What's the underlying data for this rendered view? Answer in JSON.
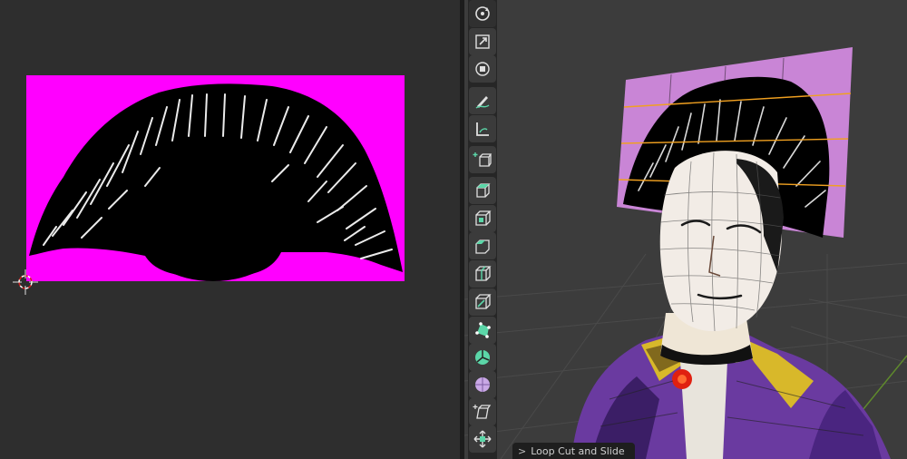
{
  "uv_editor": {
    "texture": {
      "background_color": "#ff00ff",
      "hair_color": "#000000"
    }
  },
  "toolbar": {
    "tools": [
      {
        "name": "rotate-tool",
        "icon": "rotate-icon"
      },
      {
        "name": "scale-tool",
        "icon": "scale-icon"
      },
      {
        "name": "transform-tool",
        "icon": "transform-icon"
      },
      {
        "name": "annotate-tool",
        "icon": "annotate-icon"
      },
      {
        "name": "measure-tool",
        "icon": "measure-icon"
      },
      {
        "name": "add-cube-tool",
        "icon": "add-cube-icon"
      },
      {
        "name": "extrude-region-tool",
        "icon": "extrude-icon"
      },
      {
        "name": "inset-faces-tool",
        "icon": "inset-icon"
      },
      {
        "name": "bevel-tool",
        "icon": "bevel-icon"
      },
      {
        "name": "loop-cut-tool",
        "icon": "loop-cut-icon"
      },
      {
        "name": "knife-tool",
        "icon": "knife-icon"
      },
      {
        "name": "poly-build-tool",
        "icon": "poly-build-icon"
      },
      {
        "name": "spin-tool",
        "icon": "spin-icon"
      },
      {
        "name": "smooth-tool",
        "icon": "smooth-icon"
      },
      {
        "name": "shear-tool",
        "icon": "shear-icon"
      },
      {
        "name": "shrink-fatten-tool",
        "icon": "shrink-fatten-icon"
      }
    ]
  },
  "operator_panel": {
    "label": "Loop Cut and Slide",
    "chevron": ">"
  },
  "colors": {
    "accent": "#5bd6a8",
    "uv_magenta": "#ff00ff",
    "edge_highlight": "#f0a020"
  }
}
